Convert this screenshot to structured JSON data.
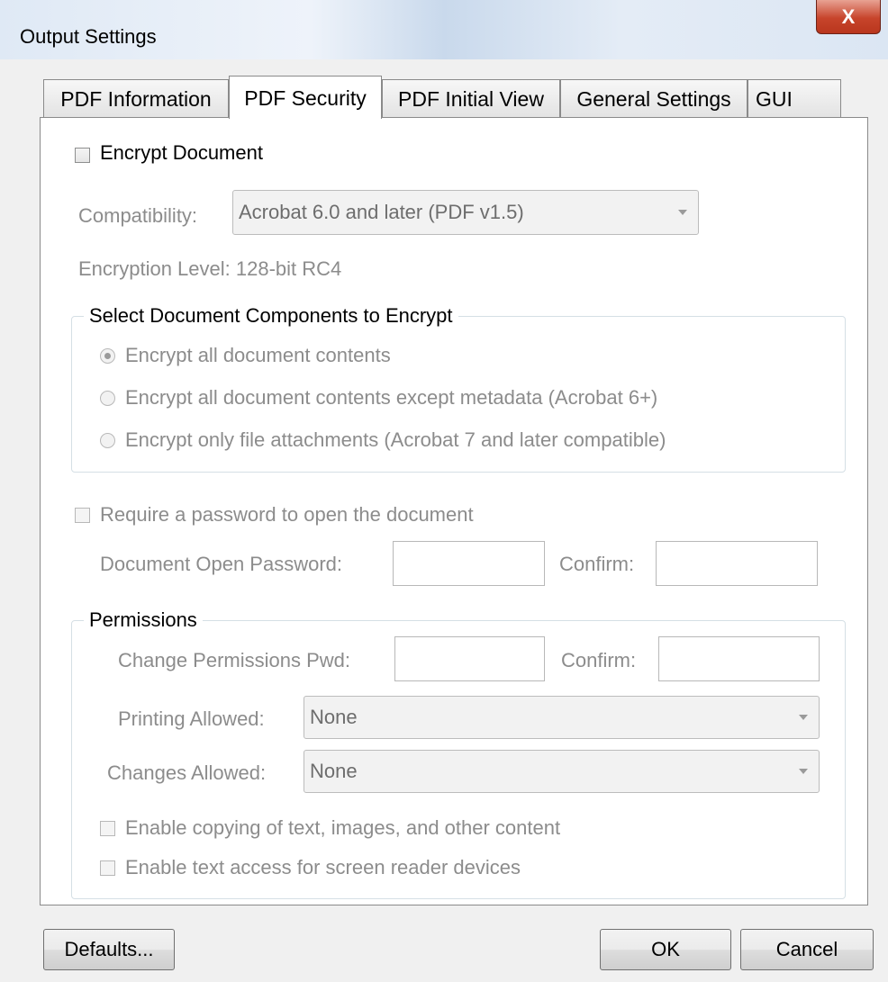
{
  "window": {
    "title": "Output Settings",
    "close_glyph": "X"
  },
  "tabs": [
    {
      "label": "PDF Information"
    },
    {
      "label": "PDF Security"
    },
    {
      "label": "PDF Initial View"
    },
    {
      "label": "General Settings"
    },
    {
      "label": "GUI"
    }
  ],
  "active_tab": "PDF Security",
  "security": {
    "encrypt_document": {
      "label": "Encrypt Document",
      "checked": false
    },
    "compatibility": {
      "label": "Compatibility:",
      "value": "Acrobat 6.0 and later (PDF v1.5)"
    },
    "encryption_level": "Encryption Level: 128-bit RC4",
    "components_group": {
      "title": "Select Document Components to Encrypt",
      "options": [
        {
          "label": "Encrypt all document contents",
          "selected": true
        },
        {
          "label": "Encrypt all document contents except metadata (Acrobat 6+)",
          "selected": false
        },
        {
          "label": "Encrypt only file attachments (Acrobat 7 and later compatible)",
          "selected": false
        }
      ]
    },
    "require_open_password": {
      "label": "Require a password to open the document",
      "checked": false
    },
    "open_password": {
      "label": "Document Open Password:",
      "value": "",
      "confirm_label": "Confirm:",
      "confirm_value": ""
    },
    "permissions": {
      "title": "Permissions",
      "change_password": {
        "label": "Change Permissions Pwd:",
        "value": "",
        "confirm_label": "Confirm:",
        "confirm_value": ""
      },
      "printing_allowed": {
        "label": "Printing Allowed:",
        "value": "None"
      },
      "changes_allowed": {
        "label": "Changes Allowed:",
        "value": "None"
      },
      "enable_copying": {
        "label": "Enable copying of text, images, and other content",
        "checked": false
      },
      "enable_screen_reader": {
        "label": "Enable text access for screen reader devices",
        "checked": false
      }
    }
  },
  "buttons": {
    "defaults": "Defaults...",
    "ok": "OK",
    "cancel": "Cancel"
  },
  "icons": [
    "close-icon",
    "dropdown-arrow-icon"
  ]
}
